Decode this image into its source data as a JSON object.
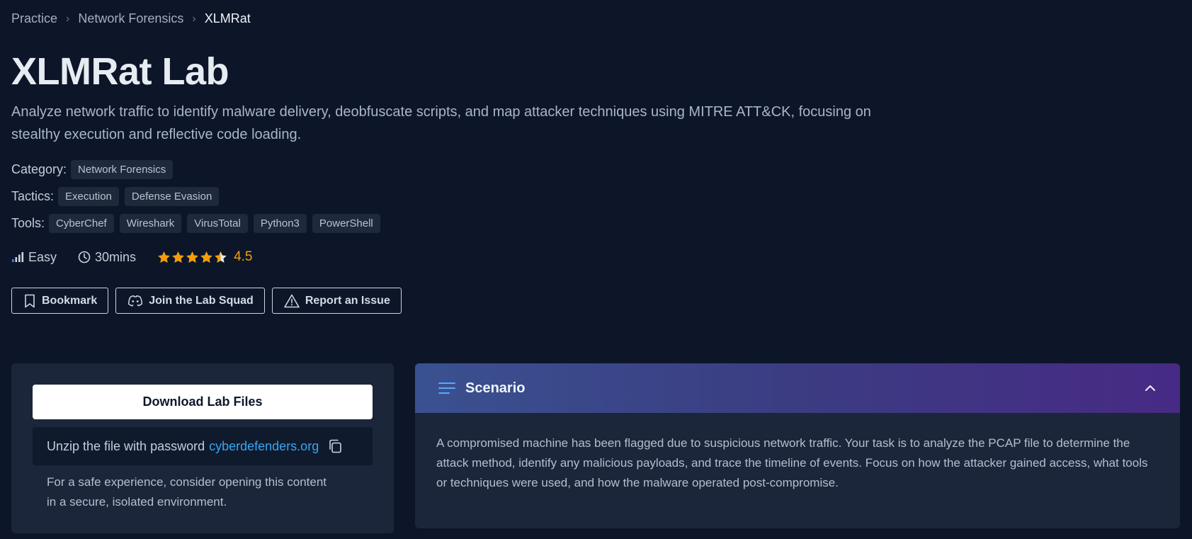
{
  "breadcrumb": {
    "items": [
      "Practice",
      "Network Forensics"
    ],
    "current": "XLMRat"
  },
  "title": "XLMRat Lab",
  "subtitle": "Analyze network traffic to identify malware delivery, deobfuscate scripts, and map attacker techniques using MITRE ATT&CK, focusing on stealthy execution and reflective code loading.",
  "category": {
    "label": "Category:",
    "tags": [
      "Network Forensics"
    ]
  },
  "tactics": {
    "label": "Tactics:",
    "tags": [
      "Execution",
      "Defense Evasion"
    ]
  },
  "tools": {
    "label": "Tools:",
    "tags": [
      "CyberChef",
      "Wireshark",
      "VirusTotal",
      "Python3",
      "PowerShell"
    ]
  },
  "stats": {
    "difficulty": "Easy",
    "duration": "30mins",
    "rating": "4.5",
    "rating_value": 4.5,
    "rating_max": 5,
    "star_color": "#f59e0b"
  },
  "actions": {
    "bookmark": "Bookmark",
    "squad": "Join the Lab Squad",
    "report": "Report an Issue"
  },
  "download": {
    "button": "Download Lab Files",
    "password_prefix": "Unzip the file with password",
    "password": "cyberdefenders.org",
    "note": "For a safe experience, consider opening this content in a secure, isolated environment."
  },
  "scenario": {
    "title": "Scenario",
    "text": "A compromised machine has been flagged due to suspicious network traffic. Your task is to analyze the PCAP file to determine the attack method, identify any malicious payloads, and trace the timeline of events. Focus on how the attacker gained access, what tools or techniques were used, and how the malware operated post-compromise."
  },
  "icons": {
    "difficulty": "signal-bars-icon",
    "duration": "clock-icon",
    "rating": "star-icon",
    "bookmark": "bookmark-icon",
    "squad": "discord-icon",
    "report": "warning-triangle-icon",
    "copy": "copy-icon",
    "scenario": "menu-lines-icon",
    "collapse": "chevron-up-icon"
  }
}
